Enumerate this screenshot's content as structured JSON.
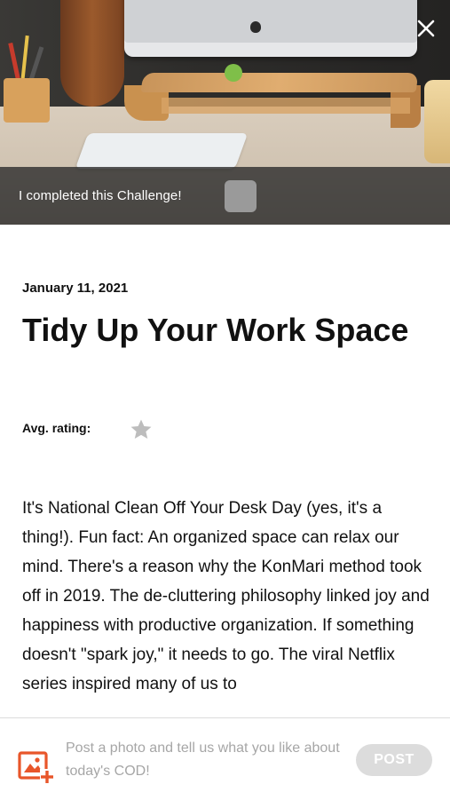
{
  "hero": {
    "completed_label": "I completed this Challenge!"
  },
  "article": {
    "date": "January 11, 2021",
    "title": "Tidy Up Your Work Space",
    "rating_label": "Avg. rating:",
    "rating_value": 0,
    "body": "It's National Clean Off Your Desk Day (yes, it's a thing!). Fun fact: An organized space can relax our mind. There's a reason why the KonMari method took off in 2019. The de-cluttering philosophy linked joy and happiness with productive organization. If something doesn't \"spark joy,\" it needs to go. The viral Netflix series inspired many of us to"
  },
  "bottom": {
    "prompt": "Post a photo and tell us what you like about today's COD!",
    "post_label": "POST"
  },
  "colors": {
    "accent": "#e8562a",
    "star": "#bdbdbd",
    "post_button": "#dcdcdc"
  },
  "icons": {
    "close": "close-icon",
    "star": "star-icon",
    "photo": "add-photo-icon"
  }
}
